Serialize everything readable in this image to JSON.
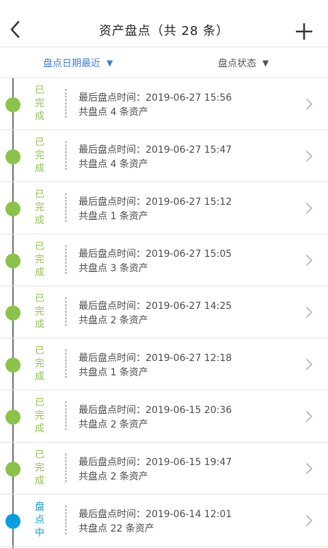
{
  "header": {
    "title": "资产盘点（共 28 条）",
    "back_icon": "chevron-left-icon",
    "add_icon": "plus-icon"
  },
  "filters": {
    "date_label": "盘点日期最近",
    "status_label": "盘点状态",
    "active_color": "#3e7fd6"
  },
  "colors": {
    "done": "#8bc34a",
    "in_progress": "#0a9ee0"
  },
  "records": [
    {
      "status": "已完成",
      "state": "done",
      "time_label": "最后盘点时间：",
      "time": "2019-06-27 15:56",
      "count_text": "共盘点 4 条资产"
    },
    {
      "status": "已完成",
      "state": "done",
      "time_label": "最后盘点时间：",
      "time": "2019-06-27 15:47",
      "count_text": "共盘点 4 条资产"
    },
    {
      "status": "已完成",
      "state": "done",
      "time_label": "最后盘点时间：",
      "time": "2019-06-27 15:12",
      "count_text": "共盘点 1 条资产"
    },
    {
      "status": "已完成",
      "state": "done",
      "time_label": "最后盘点时间：",
      "time": "2019-06-27 15:05",
      "count_text": "共盘点 3 条资产"
    },
    {
      "status": "已完成",
      "state": "done",
      "time_label": "最后盘点时间：",
      "time": "2019-06-27 14:25",
      "count_text": "共盘点 2 条资产"
    },
    {
      "status": "已完成",
      "state": "done",
      "time_label": "最后盘点时间：",
      "time": "2019-06-27 12:18",
      "count_text": "共盘点 1 条资产"
    },
    {
      "status": "已完成",
      "state": "done",
      "time_label": "最后盘点时间：",
      "time": "2019-06-15 20:36",
      "count_text": "共盘点 2 条资产"
    },
    {
      "status": "已完成",
      "state": "done",
      "time_label": "最后盘点时间：",
      "time": "2019-06-15 19:47",
      "count_text": "共盘点 2 条资产"
    },
    {
      "status": "盘点中",
      "state": "in_progress",
      "time_label": "最后盘点时间：",
      "time": "2019-06-14 12:01",
      "count_text": "共盘点 22 条资产"
    }
  ]
}
